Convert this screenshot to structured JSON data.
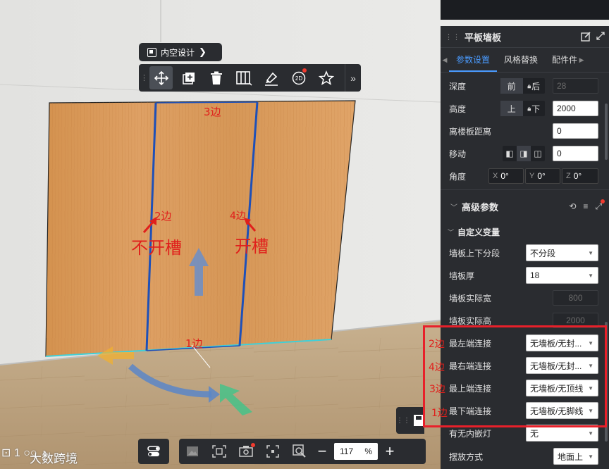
{
  "annotations": {
    "edge3": "3边",
    "edge2": "2边",
    "edge4": "4边",
    "edge1": "1边",
    "no_slot": "不开槽",
    "slot": "开槽",
    "panel_edge2": "2边",
    "panel_edge4": "4边",
    "panel_edge3": "3边",
    "panel_edge1": "1边"
  },
  "context_title": "内空设计",
  "toolbar": {
    "icons": [
      "move-icon",
      "add-icon",
      "delete-icon",
      "split-icon",
      "brush-icon",
      "2d-icon",
      "star-icon"
    ],
    "more": "»"
  },
  "bottom_bar": {
    "zoom_value": "117",
    "zoom_unit": "%",
    "minus": "−",
    "plus": "+"
  },
  "watermark": "大数跨境",
  "panel": {
    "title": "平板墙板",
    "tabs": [
      "参数设置",
      "风格替换",
      "配件件"
    ],
    "active_tab": 0,
    "depth": {
      "label": "深度",
      "opt1": "前",
      "opt2": "后",
      "value": "28"
    },
    "height": {
      "label": "高度",
      "opt1": "上",
      "opt2": "下",
      "value": "2000"
    },
    "floor_dist": {
      "label": "离楼板距离",
      "value": "0"
    },
    "move": {
      "label": "移动",
      "value": "0"
    },
    "angle": {
      "label": "角度",
      "x_label": "X",
      "x": "0°",
      "y_label": "Y",
      "y": "0°",
      "z_label": "Z",
      "z": "0°"
    },
    "advanced": "高级参数",
    "custom_vars": "自定义变量",
    "params": [
      {
        "label": "墙板上下分段",
        "value": "不分段",
        "type": "select"
      },
      {
        "label": "墙板厚",
        "value": "18",
        "type": "select"
      },
      {
        "label": "墙板实际宽",
        "value": "800",
        "type": "disabled"
      },
      {
        "label": "墙板实际高",
        "value": "2000",
        "type": "disabled"
      },
      {
        "label": "最左端连接",
        "value": "无墙板/无封...",
        "type": "select"
      },
      {
        "label": "最右端连接",
        "value": "无墙板/无封...",
        "type": "select"
      },
      {
        "label": "最上端连接",
        "value": "无墙板/无顶线",
        "type": "select"
      },
      {
        "label": "最下端连接",
        "value": "无墙板/无脚线",
        "type": "select"
      },
      {
        "label": "有无内嵌灯",
        "value": "无",
        "type": "select"
      },
      {
        "label": "摆放方式",
        "value": "地面上",
        "type": "select"
      }
    ]
  },
  "colors": {
    "accent": "#4a9bff",
    "annotation": "#e0201c",
    "panel_bg": "#2a2c30"
  }
}
